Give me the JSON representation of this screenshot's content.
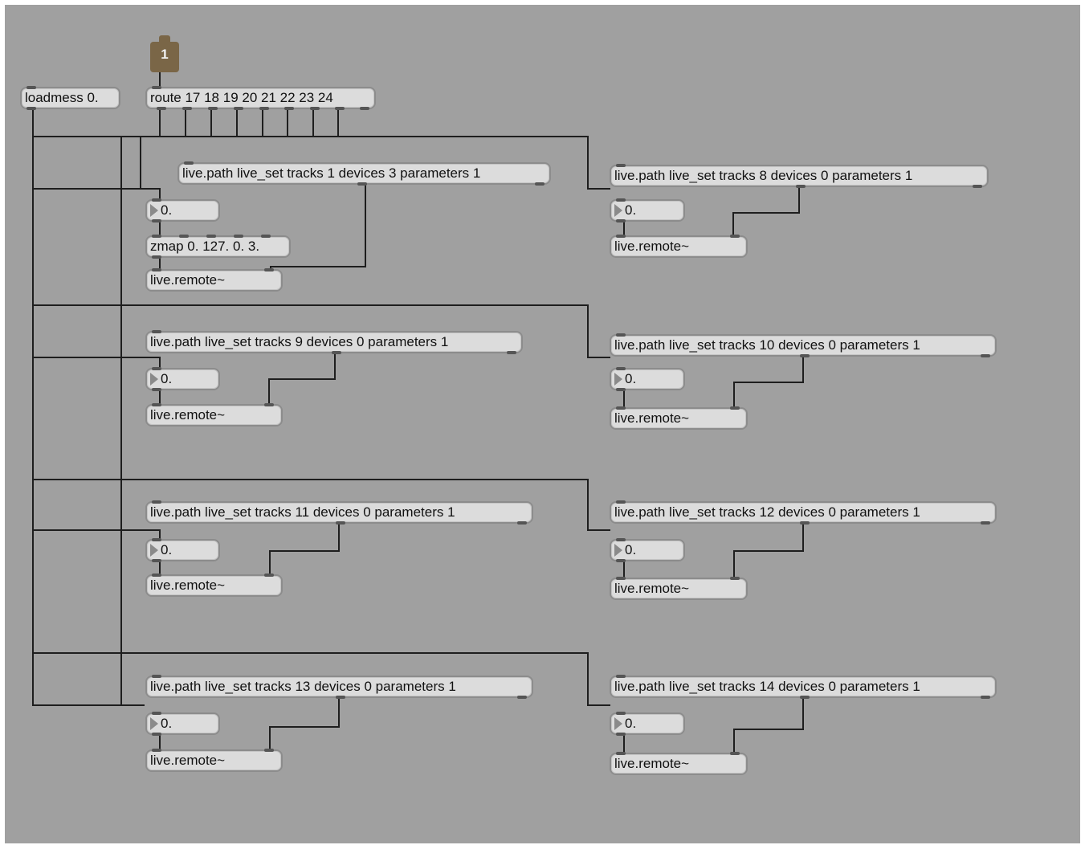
{
  "patcher": {
    "inlet_number": "1",
    "loadmess": "loadmess 0.",
    "route": "route 17 18 19 20 21 22 23 24",
    "zmap": "zmap 0. 127. 0. 3.",
    "paths": [
      "live.path live_set tracks 1 devices 3 parameters 1",
      "live.path live_set tracks 8 devices 0 parameters 1",
      "live.path live_set tracks 9 devices 0 parameters 1",
      "live.path live_set tracks 10 devices 0 parameters 1",
      "live.path live_set tracks 11 devices 0 parameters 1",
      "live.path live_set tracks 12 devices 0 parameters 1",
      "live.path live_set tracks 13 devices 0 parameters 1",
      "live.path live_set tracks 14 devices 0 parameters 1"
    ],
    "number_value": "0.",
    "remote": "live.remote~"
  },
  "colors": {
    "canvas": "#a0a0a0",
    "object_fill": "#dcdcdc",
    "cable": "#1e1e1e",
    "inlet": "#7a6647"
  }
}
